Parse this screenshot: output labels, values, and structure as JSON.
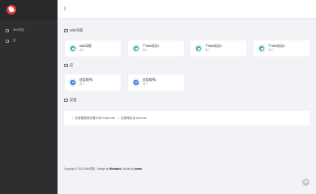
{
  "sidebar": {
    "items": [
      {
        "label": "Wiki导航",
        "icon": "compass-icon"
      },
      {
        "label": "应",
        "icon": "app-icon"
      }
    ]
  },
  "sections": {
    "wiki": {
      "title": "Wiki导航"
    },
    "apps": {
      "title": "应"
    },
    "links": {
      "title": "友链"
    }
  },
  "wiki_cards": [
    {
      "title": "Wiki导航",
      "sub": "简介"
    },
    {
      "title": "个Wiki站点1",
      "sub": "简介"
    },
    {
      "title": "个Wiki站点2",
      "sub": "简介"
    },
    {
      "title": "个Wiki站点3",
      "sub": "简介"
    }
  ],
  "app_cards": [
    {
      "title": "应用程序1",
      "sub": "简介"
    },
    {
      "title": "应用程序2",
      "sub": "简介"
    }
  ],
  "friend_links": [
    {
      "label": "友链链接地址展示@11.iyun.me"
    },
    {
      "label": "友链地址@.iyun.me"
    }
  ],
  "footer": {
    "prefix": "Copyright © 2024 Wiki导航 · Design by",
    "design": "Webstack",
    "modify_prefix": "Modify by",
    "modifier": "iowen"
  },
  "colors": {
    "sidebar": "#2c2e2f",
    "logo": "#e53935",
    "page_bg": "#f1f3f6"
  }
}
